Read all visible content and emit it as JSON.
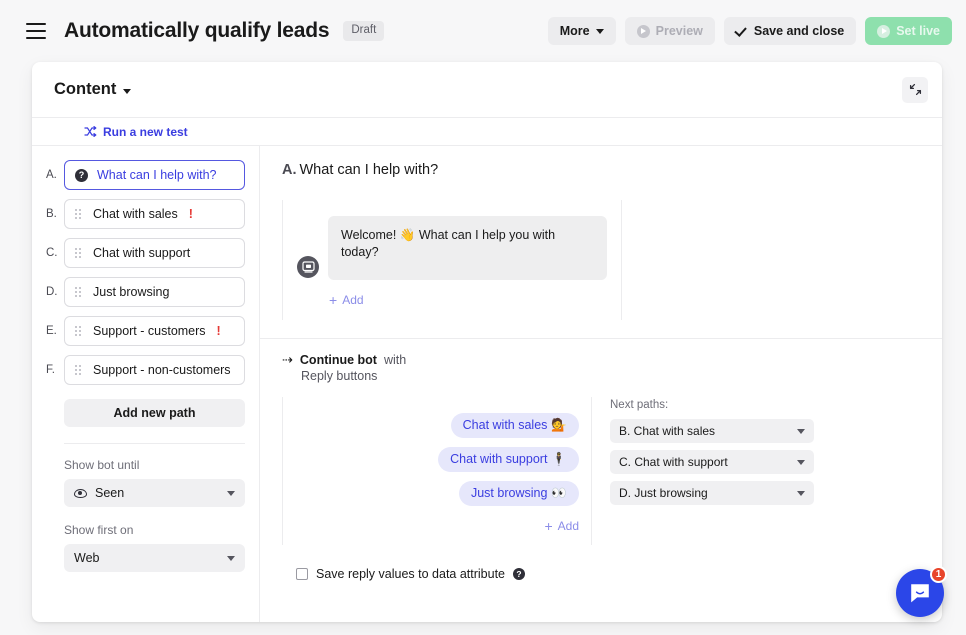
{
  "topbar": {
    "menu_icon": "hamburger-icon",
    "title": "Automatically qualify leads",
    "status_badge": "Draft",
    "more_label": "More",
    "preview_label": "Preview",
    "save_close_label": "Save and close",
    "set_live_label": "Set live"
  },
  "card": {
    "section_title": "Content",
    "expand_icon": "collapse-arrows-icon",
    "test_link": "Run a new test",
    "test_icon": "shuffle-icon"
  },
  "sidebar": {
    "paths": [
      {
        "letter": "A.",
        "label": "What can I help with?",
        "icon": "question-mark-icon",
        "selected": true,
        "warning": ""
      },
      {
        "letter": "B.",
        "label": "Chat with sales",
        "icon": "drag-handle-icon",
        "selected": false,
        "warning": "!"
      },
      {
        "letter": "C.",
        "label": "Chat with support",
        "icon": "drag-handle-icon",
        "selected": false,
        "warning": ""
      },
      {
        "letter": "D.",
        "label": "Just browsing",
        "icon": "drag-handle-icon",
        "selected": false,
        "warning": ""
      },
      {
        "letter": "E.",
        "label": "Support - customers",
        "icon": "drag-handle-icon",
        "selected": false,
        "warning": "!"
      },
      {
        "letter": "F.",
        "label": "Support - non-customers",
        "icon": "drag-handle-icon",
        "selected": false,
        "warning": ""
      }
    ],
    "add_path_label": "Add new path",
    "show_bot_until_label": "Show bot until",
    "show_bot_until_value": "Seen",
    "show_bot_until_icon": "eye-icon",
    "show_first_on_label": "Show first on",
    "show_first_on_value": "Web"
  },
  "main": {
    "step_letter": "A.",
    "step_title": "What can I help with?",
    "message_text": "Welcome! 👋 What can I help you with today?",
    "avatar_icon": "bot-message-icon",
    "add_message_label": "Add",
    "continue_prefix": "Continue bot",
    "continue_with": "with",
    "continue_type": "Reply buttons",
    "reply_buttons": [
      {
        "label": "Chat with sales",
        "emoji": "💁"
      },
      {
        "label": "Chat with support",
        "emoji": "🕴"
      },
      {
        "label": "Just browsing",
        "emoji": "👀"
      }
    ],
    "add_reply_label": "Add",
    "next_paths_label": "Next paths:",
    "next_paths": [
      "B. Chat with sales",
      "C. Chat with support",
      "D. Just browsing"
    ],
    "save_reply_label": "Save reply values to data attribute",
    "save_reply_help_icon": "help-icon",
    "save_reply_checked": false
  },
  "launcher": {
    "icon": "chat-bubble-icon",
    "unread_count": "1",
    "color": "#2b46e8",
    "badge_color": "#e8452b"
  }
}
